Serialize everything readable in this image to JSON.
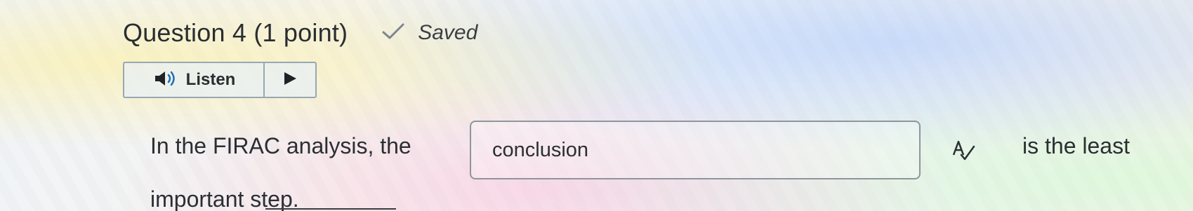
{
  "question": {
    "title": "Question 4 (1 point)",
    "status_text": "Saved",
    "status_icon": "checkmark-icon"
  },
  "listen": {
    "label": "Listen",
    "speaker_icon": "speaker-icon",
    "play_icon": "play-icon"
  },
  "prompt": {
    "before_blank": "In the FIRAC analysis, the",
    "blank_value": "conclusion",
    "after_blank": "is the least",
    "line2": "important step.",
    "spellcheck_icon": "spellcheck-icon"
  },
  "colors": {
    "accent": "#1f6fb2",
    "text": "#2b2f33",
    "border": "#9aa6b2"
  }
}
